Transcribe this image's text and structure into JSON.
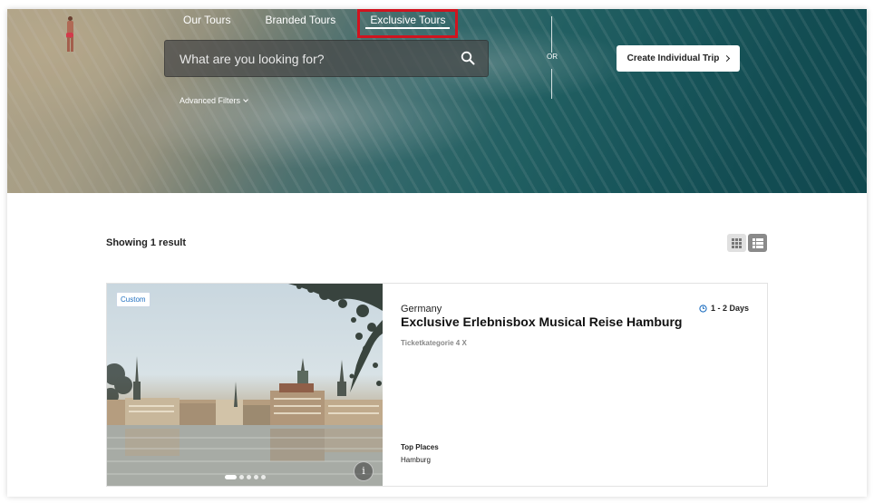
{
  "nav": {
    "tabs": [
      {
        "label": "Our Tours"
      },
      {
        "label": "Branded Tours"
      },
      {
        "label": "Exclusive Tours"
      }
    ],
    "active_tab": "Exclusive Tours"
  },
  "search": {
    "placeholder": "What are you looking for?",
    "value": "",
    "icon": "search-icon"
  },
  "filters": {
    "advanced_label": "Advanced Filters"
  },
  "divider": {
    "or_label": "OR"
  },
  "cta": {
    "create_trip_label": "Create Individual Trip"
  },
  "results": {
    "showing_label": "Showing 1 result",
    "view_modes": [
      "grid-view-icon",
      "list-view-icon"
    ],
    "active_view": "list"
  },
  "tours": [
    {
      "badge": "Custom",
      "country": "Germany",
      "title": "Exclusive Erlebnisbox Musical Reise Hamburg",
      "duration": "1 - 2 Days",
      "subcategory": "Ticketkategorie 4 X",
      "top_places_label": "Top Places",
      "top_places": "Hamburg",
      "image_slides": 5,
      "active_slide": 1,
      "info_icon_glyph": "i"
    }
  ],
  "colors": {
    "highlight_box": "#d0141f",
    "badge_text": "#1f6fc0",
    "clock_icon": "#1f6fc0"
  }
}
